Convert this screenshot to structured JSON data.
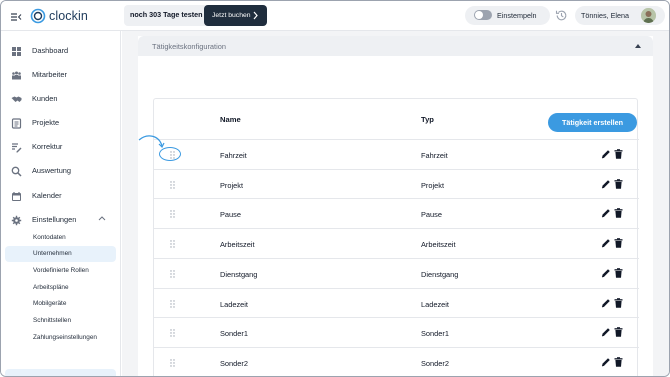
{
  "header": {
    "menu_icon": "collapse-menu-icon",
    "logo_text": "clockin",
    "trial_text": "noch 303 Tage testen",
    "trial_button": "Jetzt buchen",
    "clock_in_label": "Einstempeln",
    "user_name": "Tönnies, Elena"
  },
  "sidebar": {
    "items": [
      {
        "label": "Dashboard",
        "icon": "dashboard-icon"
      },
      {
        "label": "Mitarbeiter",
        "icon": "employees-icon"
      },
      {
        "label": "Kunden",
        "icon": "handshake-icon"
      },
      {
        "label": "Projekte",
        "icon": "projects-icon"
      },
      {
        "label": "Korrektur",
        "icon": "correction-icon"
      },
      {
        "label": "Auswertung",
        "icon": "analysis-icon"
      },
      {
        "label": "Kalender",
        "icon": "calendar-icon"
      },
      {
        "label": "Einstellungen",
        "icon": "gear-icon"
      }
    ],
    "sub_items": [
      {
        "label": "Kontodaten"
      },
      {
        "label": "Unternehmen",
        "active": true
      },
      {
        "label": "Vordefinierte Rollen"
      },
      {
        "label": "Arbeitspläne"
      },
      {
        "label": "Mobilgeräte"
      },
      {
        "label": "Schnittstellen"
      },
      {
        "label": "Zahlungseinstellungen"
      }
    ]
  },
  "main": {
    "section_title": "Tätigkeitskonfiguration",
    "table": {
      "col_name": "Name",
      "col_type": "Typ",
      "create_button": "Tätigkeit erstellen",
      "rows": [
        {
          "name": "Fahrzeit",
          "type": "Fahrzeit"
        },
        {
          "name": "Projekt",
          "type": "Projekt"
        },
        {
          "name": "Pause",
          "type": "Pause"
        },
        {
          "name": "Arbeitszeit",
          "type": "Arbeitszeit"
        },
        {
          "name": "Dienstgang",
          "type": "Dienstgang"
        },
        {
          "name": "Ladezeit",
          "type": "Ladezeit"
        },
        {
          "name": "Sonder1",
          "type": "Sonder1"
        },
        {
          "name": "Sonder2",
          "type": "Sonder2"
        }
      ]
    }
  },
  "colors": {
    "accent": "#3b9ae1",
    "trial_button": "#1f2d3d",
    "active_nav": "#e8f2fb"
  }
}
